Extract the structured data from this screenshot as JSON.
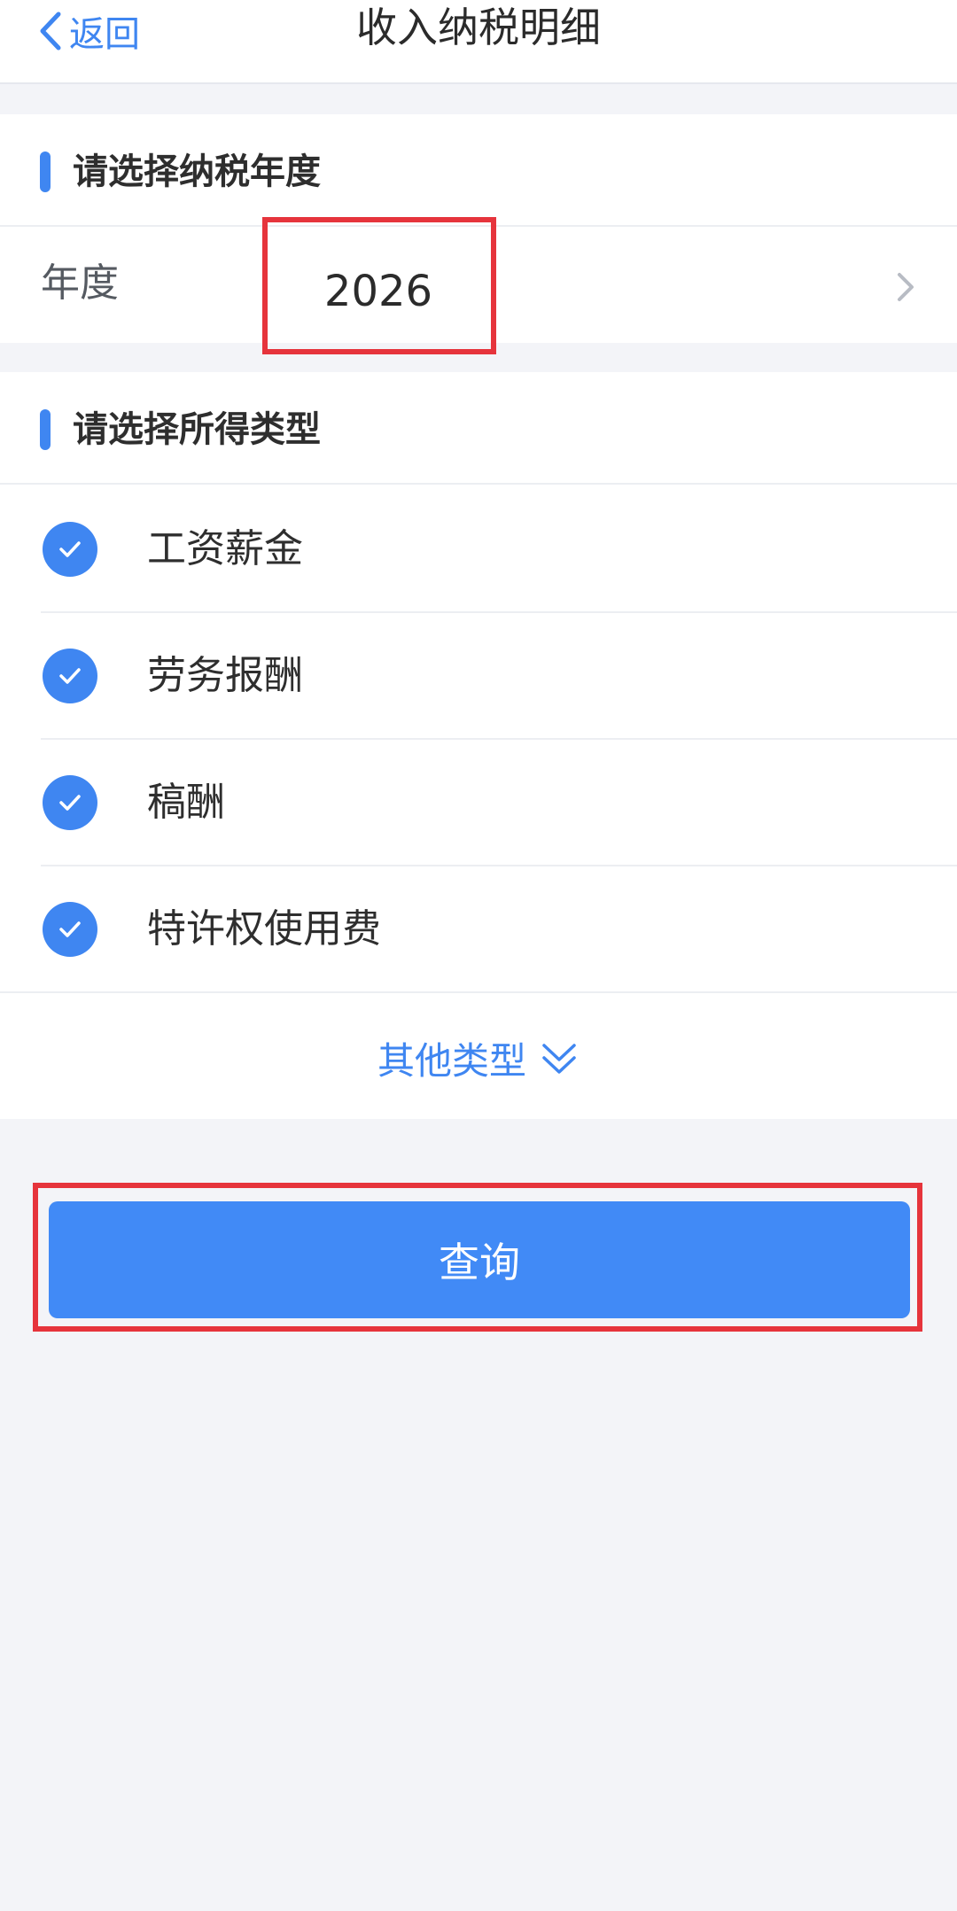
{
  "nav": {
    "back_label": "返回",
    "title": "收入纳税明细"
  },
  "year_section": {
    "title": "请选择纳税年度",
    "row_label": "年度",
    "value": "2026"
  },
  "type_section": {
    "title": "请选择所得类型",
    "items": [
      {
        "label": "工资薪金",
        "checked": true
      },
      {
        "label": "劳务报酬",
        "checked": true
      },
      {
        "label": "稿酬",
        "checked": true
      },
      {
        "label": "特许权使用费",
        "checked": true
      }
    ],
    "more_label": "其他类型"
  },
  "query_button": {
    "label": "查询"
  },
  "colors": {
    "accent": "#3f86f1",
    "highlight": "#e6343c",
    "background": "#f3f4f8"
  },
  "icons": [
    "chevron-left-icon",
    "chevron-right-icon",
    "check-icon",
    "double-chevron-down-icon"
  ]
}
